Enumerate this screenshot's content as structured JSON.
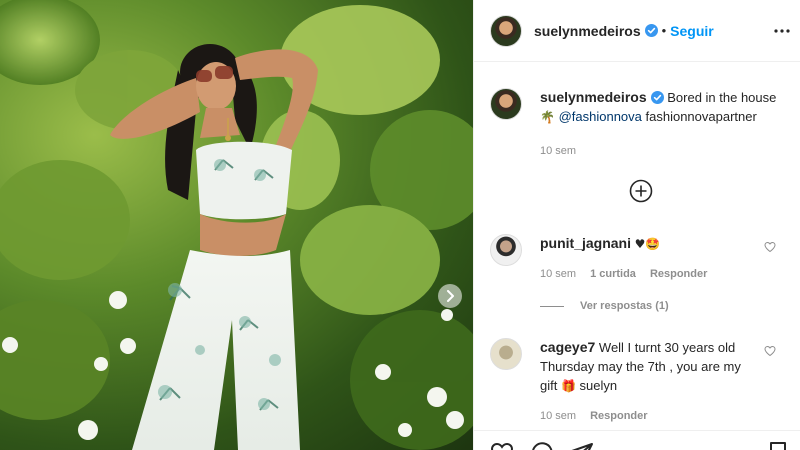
{
  "post": {
    "author": "suelynmedeiros",
    "follow_label": "Seguir",
    "separator": "•",
    "caption_text": "Bored in the house",
    "caption_emoji": "🌴",
    "caption_mention": "@fashionnova",
    "caption_tag": "fashionnovapartner",
    "time": "10 sem"
  },
  "comments": [
    {
      "user": "punit_jagnani",
      "text": "♥🤩",
      "time": "10 sem",
      "likes": "1 curtida",
      "reply_label": "Responder",
      "view_replies": "Ver respostas (1)"
    },
    {
      "user": "cageye7",
      "text_part1": "Well I turnt 30 years old Thursday may the 7th , you are my gift",
      "emoji": "🎁",
      "text_part2": "suelyn",
      "time": "10 sem",
      "reply_label": "Responder"
    }
  ],
  "icons": {
    "verified": "verified-badge-icon",
    "more": "more-options-icon",
    "load_more": "plus-circle-icon",
    "heart": "heart-icon",
    "comment": "comment-icon",
    "share": "share-icon",
    "save": "bookmark-icon",
    "carousel_next": "chevron-right-icon"
  },
  "colors": {
    "accent": "#0095f6",
    "text": "#262626",
    "muted": "#8e8e8e",
    "mention": "#00376b"
  }
}
